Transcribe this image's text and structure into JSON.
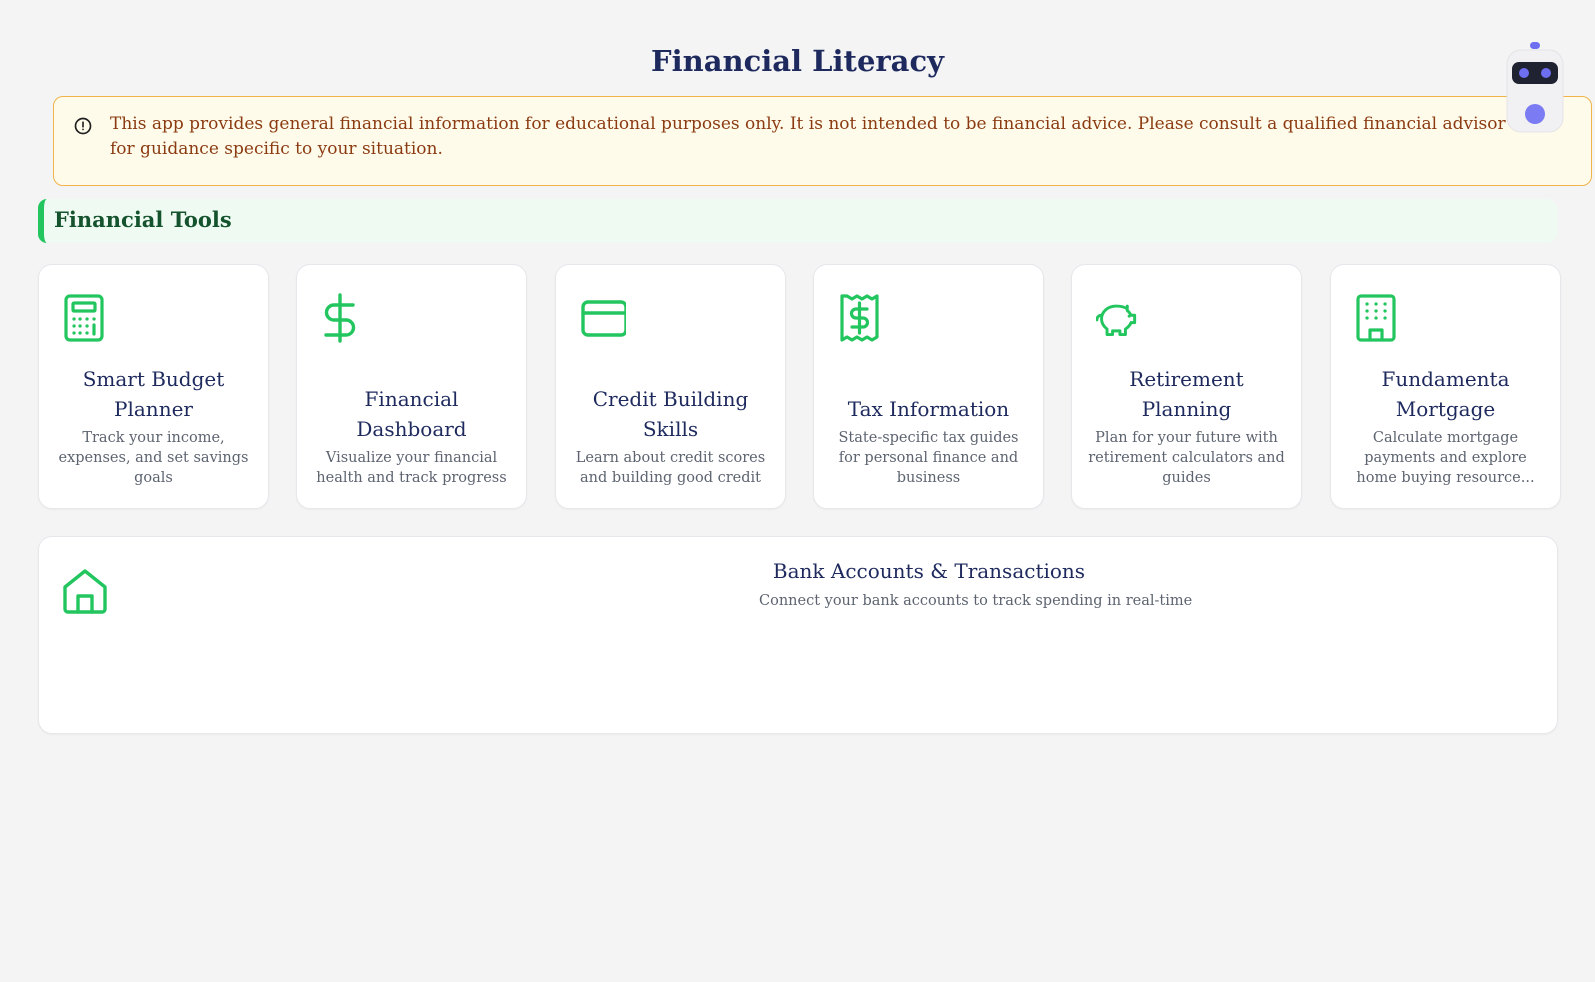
{
  "page": {
    "title": "Financial Literacy"
  },
  "disclaimer": {
    "icon": "info-circle-icon",
    "text": "This app provides general financial information for educational purposes only. It is not intended to be financial advice. Please consult a qualified financial advisor for guidance specific to your situation."
  },
  "section": {
    "title": "Financial Tools"
  },
  "tools": [
    {
      "icon": "calculator-icon",
      "title": "Smart Budget Planner",
      "description": "Track your income, expenses, and set savings goals"
    },
    {
      "icon": "dollar-icon",
      "title": "Financial Dashboard",
      "description": "Visualize your financial health and track progress"
    },
    {
      "icon": "credit-card-icon",
      "title": "Credit Building Skills",
      "description": "Learn about credit scores and building good credit"
    },
    {
      "icon": "receipt-icon",
      "title": "Tax Information",
      "description": "State-specific tax guides for personal finance and business"
    },
    {
      "icon": "piggy-bank-icon",
      "title": "Retirement Planning",
      "description": "Plan for your future with retirement calculators and guides"
    },
    {
      "icon": "building-icon",
      "title": "Fundamenta Mortgage",
      "description": "Calculate mortgage payments and explore home buying resource..."
    }
  ],
  "bank": {
    "icon": "home-icon",
    "title": "Bank Accounts & Transactions",
    "description": "Connect your bank accounts to track spending in real-time"
  },
  "assistant": {
    "icon": "robot-icon"
  },
  "colors": {
    "accent": "#22c55e",
    "title": "#1e2a5e",
    "warning_bg": "#fffbea",
    "warning_border": "#f0b44a",
    "warning_text": "#8b3b12",
    "robot_accent": "#6d6ef0"
  }
}
